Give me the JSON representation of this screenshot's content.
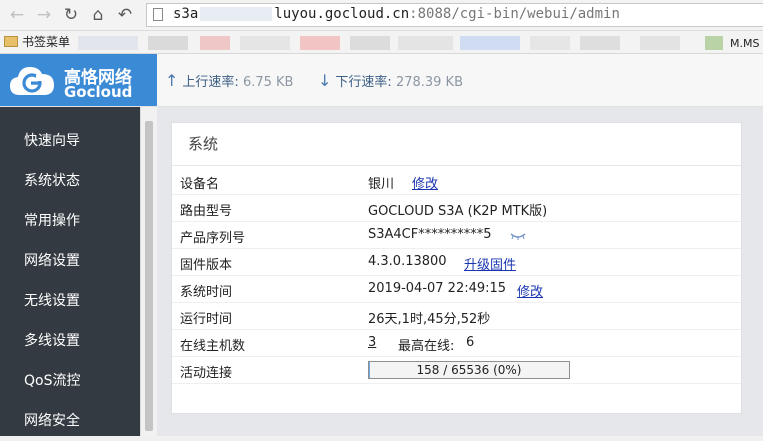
{
  "browser": {
    "url_prefix": "s3a",
    "url_host": "luyou.gocloud.cn",
    "url_port": ":8088",
    "url_path": "/cgi-bin/webui/admin",
    "bookmarks_folder": "书签菜单",
    "bookmark_last": "M.MS -"
  },
  "header": {
    "logo_title": "高恪网络",
    "logo_subtitle": "Gocloud",
    "upload_label": "上行速率:",
    "upload_value": "6.75 KB",
    "download_label": "下行速率:",
    "download_value": "278.39 KB",
    "colors": {
      "brand_blue": "#3b8ad6",
      "sidebar_bg": "#333a41",
      "link": "#1a35b0"
    }
  },
  "sidebar": {
    "items": [
      {
        "label": "快速向导"
      },
      {
        "label": "系统状态"
      },
      {
        "label": "常用操作"
      },
      {
        "label": "网络设置"
      },
      {
        "label": "无线设置"
      },
      {
        "label": "多线设置"
      },
      {
        "label": "QoS流控"
      },
      {
        "label": "网络安全"
      }
    ]
  },
  "system": {
    "title": "系统",
    "device_name_label": "设备名",
    "device_name": "银川",
    "device_name_action": "修改",
    "model_label": "路由型号",
    "model": "GOCLOUD S3A (K2P MTK版)",
    "serial_label": "产品序列号",
    "serial": "S3A4CF**********5",
    "firmware_label": "固件版本",
    "firmware": "4.3.0.13800",
    "firmware_action": "升级固件",
    "time_label": "系统时间",
    "time": "2019-04-07 22:49:15",
    "time_action": "修改",
    "uptime_label": "运行时间",
    "uptime": "26天,1时,45分,52秒",
    "hosts_label": "在线主机数",
    "hosts_online": "3",
    "hosts_peak_label": "最高在线:",
    "hosts_peak": "6",
    "connections_label": "活动连接",
    "connections_text": "158 / 65536 (0%)",
    "connections_fraction": 0.0024
  }
}
